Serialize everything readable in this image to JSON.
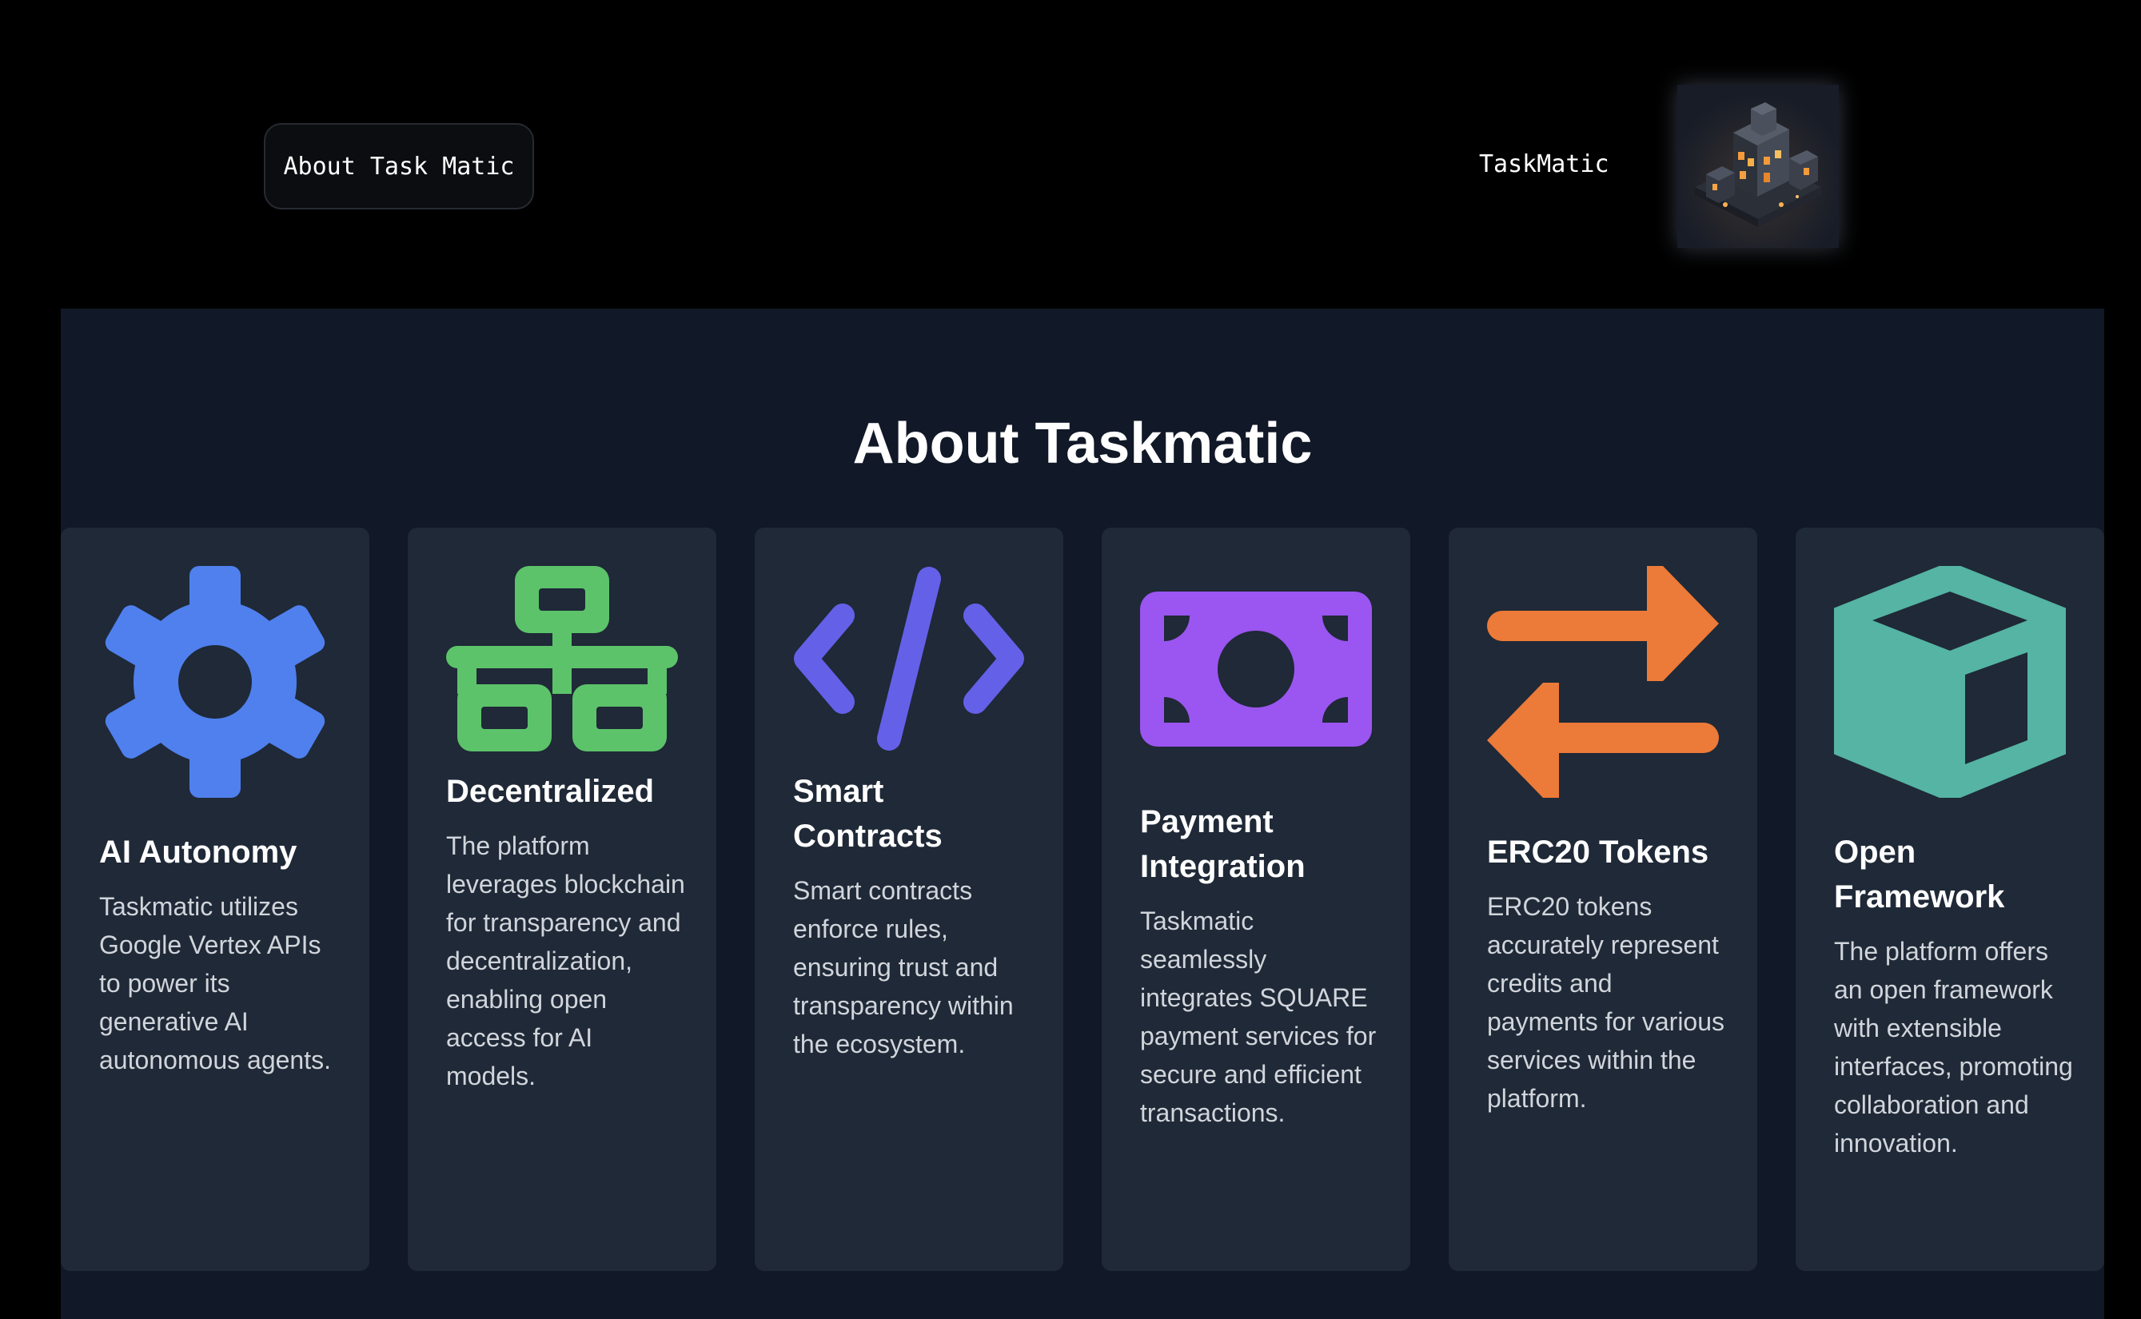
{
  "header": {
    "about_button_label": "About Task Matic",
    "brand_name": "TaskMatic",
    "logo_icon": "isometric-building-logo"
  },
  "section": {
    "title": "About Taskmatic"
  },
  "cards": [
    {
      "title": "AI Autonomy",
      "description": "Taskmatic utilizes Google Vertex APIs to power its generative AI autonomous agents.",
      "icon": "gear-icon",
      "color": "#4f80ee"
    },
    {
      "title": "Decentralized",
      "description": "The platform leverages blockchain for transparency and decentralization, enabling open access for AI models.",
      "icon": "network-icon",
      "color": "#5cc36a"
    },
    {
      "title": "Smart Contracts",
      "description": "Smart contracts enforce rules, ensuring trust and transparency within the ecosystem.",
      "icon": "code-icon",
      "color": "#6460e8"
    },
    {
      "title": "Payment Integration",
      "description": "Taskmatic seamlessly integrates SQUARE payment services for secure and efficient transactions.",
      "icon": "money-bill-icon",
      "color": "#9b55f0"
    },
    {
      "title": "ERC20 Tokens",
      "description": "ERC20 tokens accurately represent credits and payments for various services within the platform.",
      "icon": "exchange-arrows-icon",
      "color": "#ec7a38"
    },
    {
      "title": "Open Framework",
      "description": "The platform offers an open framework with extensible interfaces, promoting collaboration and innovation.",
      "icon": "cube-icon",
      "color": "#55b4a4"
    }
  ]
}
